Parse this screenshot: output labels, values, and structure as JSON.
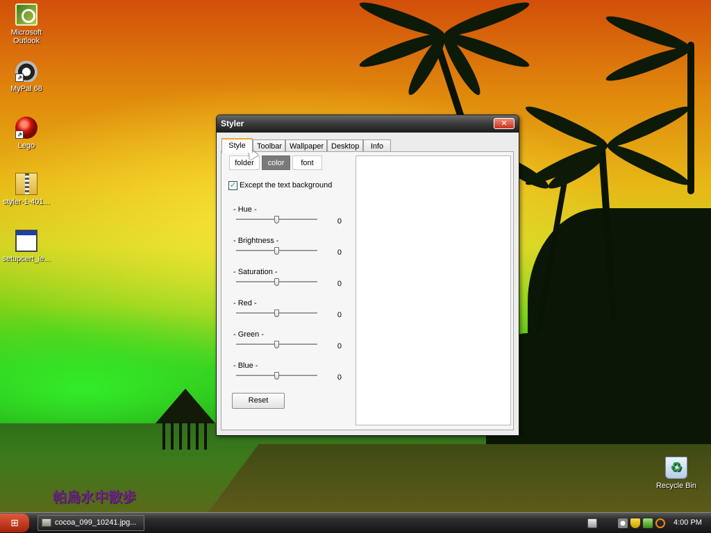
{
  "desktop": {
    "icons": [
      {
        "label": "Microsoft\nOutlook",
        "icon": "outlook-icon"
      },
      {
        "label": "MyPal 68",
        "icon": "mypal-icon"
      },
      {
        "label": "Lego",
        "icon": "lego-icon"
      },
      {
        "label": "styler-1-401...",
        "icon": "zip-archive-icon"
      },
      {
        "label": "setupcert_le...",
        "icon": "application-window-icon"
      },
      {
        "label": "Recycle Bin",
        "icon": "recycle-bin-icon"
      }
    ],
    "watermark": "帕烏水中散歩"
  },
  "window": {
    "title": "Styler",
    "close_glyph": "✕",
    "tabs": [
      "Style",
      "Toolbar",
      "Wallpaper",
      "Desktop",
      "Info"
    ],
    "active_tab": "Style",
    "subtabs": [
      "folder",
      "color",
      "font"
    ],
    "active_subtab": "color",
    "checkbox": {
      "label": "Except the text background",
      "checked": true,
      "glyph": "✓"
    },
    "sliders": [
      {
        "label": "- Hue -",
        "value": "0"
      },
      {
        "label": "- Brightness -",
        "value": "0"
      },
      {
        "label": "- Saturation -",
        "value": "0"
      },
      {
        "label": "- Red -",
        "value": "0"
      },
      {
        "label": "- Green -",
        "value": "0"
      },
      {
        "label": "- Blue -",
        "value": "0"
      }
    ],
    "reset_label": "Reset"
  },
  "taskbar": {
    "start_icon": "windows-logo-icon",
    "task_label": "cocoa_099_10241.jpg...",
    "tray_icons": [
      "keyboard-icon",
      "speaker-icon",
      "shield-icon",
      "network-icon",
      "search-icon"
    ],
    "clock": "4:00 PM"
  },
  "colors": {
    "accent_tab": "#f0a030",
    "close_button": "#c8301c",
    "active_subtab": "#7a7a7a"
  }
}
